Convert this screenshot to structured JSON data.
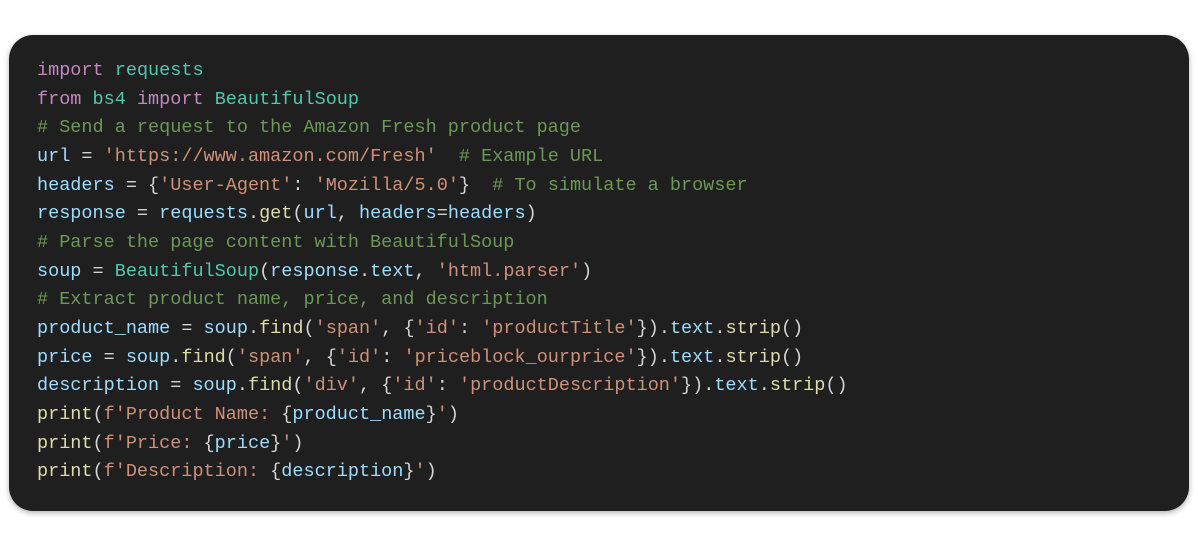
{
  "code": {
    "l1_import": "import",
    "l1_requests": "requests",
    "l2_from": "from",
    "l2_bs4": "bs4",
    "l2_import": "import",
    "l2_beautifulsoup": "BeautifulSoup",
    "l3_comment": "# Send a request to the Amazon Fresh product page",
    "l4_url": "url",
    "l4_eq": " = ",
    "l4_str": "'https://www.amazon.com/Fresh'",
    "l4_comment": "  # Example URL",
    "l5_headers": "headers",
    "l5_eq": " = {",
    "l5_k": "'User-Agent'",
    "l5_colon": ": ",
    "l5_v": "'Mozilla/5.0'",
    "l5_close": "}",
    "l5_comment": "  # To simulate a browser",
    "l6_response": "response",
    "l6_eq": " = ",
    "l6_requests": "requests",
    "l6_dot1": ".",
    "l6_get": "get",
    "l6_open": "(",
    "l6_url": "url",
    "l6_comma": ", ",
    "l6_hkw": "headers",
    "l6_assign": "=",
    "l6_harg": "headers",
    "l6_close": ")",
    "l7_comment": "# Parse the page content with BeautifulSoup",
    "l8_soup": "soup",
    "l8_eq": " = ",
    "l8_cls": "BeautifulSoup",
    "l8_open": "(",
    "l8_resp": "response",
    "l8_dot": ".",
    "l8_text": "text",
    "l8_comma": ", ",
    "l8_parser": "'html.parser'",
    "l8_close": ")",
    "l9_comment": "# Extract product name, price, and description",
    "l10_var": "product_name",
    "l10_eq": " = ",
    "l10_soup": "soup",
    "l10_dot1": ".",
    "l10_find": "find",
    "l10_open": "(",
    "l10_tag": "'span'",
    "l10_comma": ", {",
    "l10_idk": "'id'",
    "l10_colon": ": ",
    "l10_idv": "'productTitle'",
    "l10_close1": "}).",
    "l10_text": "text",
    "l10_dot2": ".",
    "l10_strip": "strip",
    "l10_close2": "()",
    "l11_var": "price",
    "l11_eq": " = ",
    "l11_soup": "soup",
    "l11_dot1": ".",
    "l11_find": "find",
    "l11_open": "(",
    "l11_tag": "'span'",
    "l11_comma": ", {",
    "l11_idk": "'id'",
    "l11_colon": ": ",
    "l11_idv": "'priceblock_ourprice'",
    "l11_close1": "}).",
    "l11_text": "text",
    "l11_dot2": ".",
    "l11_strip": "strip",
    "l11_close2": "()",
    "l12_var": "description",
    "l12_eq": " = ",
    "l12_soup": "soup",
    "l12_dot1": ".",
    "l12_find": "find",
    "l12_open": "(",
    "l12_tag": "'div'",
    "l12_comma": ", {",
    "l12_idk": "'id'",
    "l12_colon": ": ",
    "l12_idv": "'productDescription'",
    "l12_close1": "}).",
    "l12_text": "text",
    "l12_dot2": ".",
    "l12_strip": "strip",
    "l12_close2": "()",
    "l13_print": "print",
    "l13_open": "(",
    "l13_f": "f'Product Name: ",
    "l13_ob": "{",
    "l13_expr": "product_name",
    "l13_cb": "}",
    "l13_end": "'",
    "l13_close": ")",
    "l14_print": "print",
    "l14_open": "(",
    "l14_f": "f'Price: ",
    "l14_ob": "{",
    "l14_expr": "price",
    "l14_cb": "}",
    "l14_end": "'",
    "l14_close": ")",
    "l15_print": "print",
    "l15_open": "(",
    "l15_f": "f'Description: ",
    "l15_ob": "{",
    "l15_expr": "description",
    "l15_cb": "}",
    "l15_end": "'",
    "l15_close": ")"
  }
}
